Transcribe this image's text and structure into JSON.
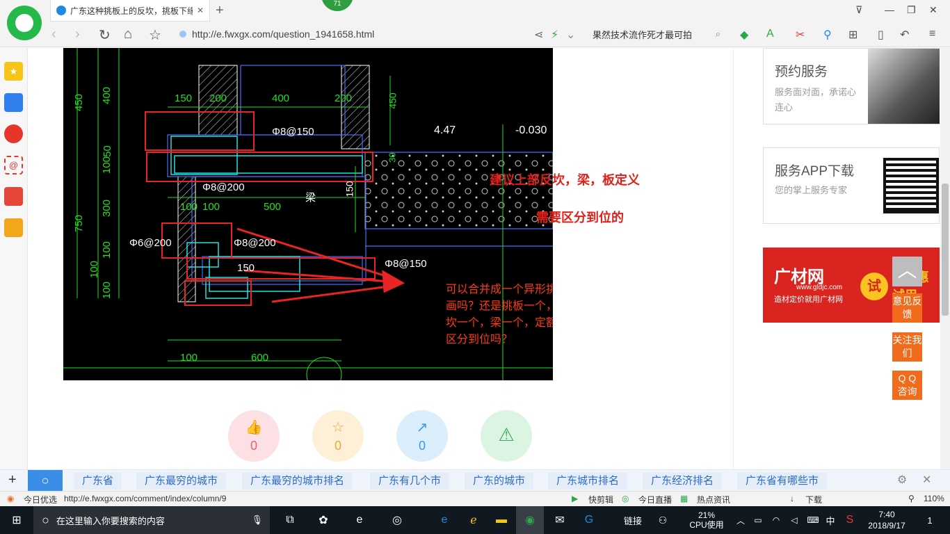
{
  "browser": {
    "tab_title": "广东这种挑板上的反坎，挑板下缘",
    "tab_close": "✕",
    "new_tab": "+",
    "badge_count": "71",
    "url": "http://e.fwxgx.com/question_1941658.html",
    "search_text": "果然技术流作死才最可拍",
    "window_controls": [
      "⊽",
      "—",
      "❐",
      "✕"
    ]
  },
  "cad": {
    "dims_top": [
      "150",
      "200",
      "400",
      "200"
    ],
    "dims_left": [
      "450",
      "400",
      "50",
      "100",
      "300",
      "750",
      "100",
      "100",
      "100"
    ],
    "dims_bottom": [
      "100",
      "600"
    ],
    "dims_mid": [
      "100",
      "100",
      "500"
    ],
    "labels": {
      "rebar1": "Φ8@150",
      "rebar2": "Φ8@200",
      "rebar3": "Φ8@200",
      "rebar4": "Φ8@150",
      "rebar5": "Φ6@200",
      "dim150": "150",
      "elev1": "4.47",
      "elev2": "-0.030",
      "beam": "梁",
      "vert150": "150",
      "vert450": "450",
      "vert30": "30"
    }
  },
  "annotations": {
    "line1": "建议上部反坎，梁，板定义",
    "line2": "需要区分到位的",
    "question": "可以合并成一个异形挑板画吗？还是挑板一个，反坎一个，梁一个，定额要区分到位吗？"
  },
  "actions": [
    {
      "icon": "👍",
      "count": "0",
      "color": "#fde0e3",
      "text_color": "#e8606f"
    },
    {
      "icon": "☆",
      "count": "0",
      "color": "#fdf0d6",
      "text_color": "#e8a83a"
    },
    {
      "icon": "↗",
      "count": "0",
      "color": "#dbeefc",
      "text_color": "#3a9ae8"
    },
    {
      "icon": "⚠",
      "count": "",
      "color": "#dcf5e2",
      "text_color": "#3aaa5a"
    }
  ],
  "right_cards": {
    "appointment_title": "预约服务",
    "appointment_desc": "服务面对面，承诺心连心",
    "app_title": "服务APP下载",
    "app_desc": "您的掌上服务专家",
    "ad_brand": "广材网",
    "ad_url": "www.gldjc.com",
    "ad_slogan": "造材定价就用广材网",
    "ad_try": "试",
    "ad_promo": "P 优惠试用"
  },
  "float_buttons": {
    "back_top": "︿",
    "feedback": "意见反馈",
    "follow": "关注我们",
    "qq": "Q Q 咨询"
  },
  "tags": [
    "广东省",
    "广东最穷的城市",
    "广东最穷的城市排名",
    "广东有几个市",
    "广东的城市",
    "广东城市排名",
    "广东经济排名",
    "广东省有哪些市"
  ],
  "status": {
    "left_label": "今日优选",
    "link": "http://e.fwxgx.com/comment/index/column/9",
    "items": [
      "快剪辑",
      "今日直播",
      "热点资讯",
      "下载"
    ],
    "zoom": "110%"
  },
  "taskbar": {
    "search_placeholder": "在这里输入你要搜索的内容",
    "link_label": "链接",
    "cpu_pct": "21%",
    "cpu_label": "CPU使用",
    "ime": "中",
    "time": "7:40",
    "date": "2018/9/17",
    "notif_count": "1"
  }
}
